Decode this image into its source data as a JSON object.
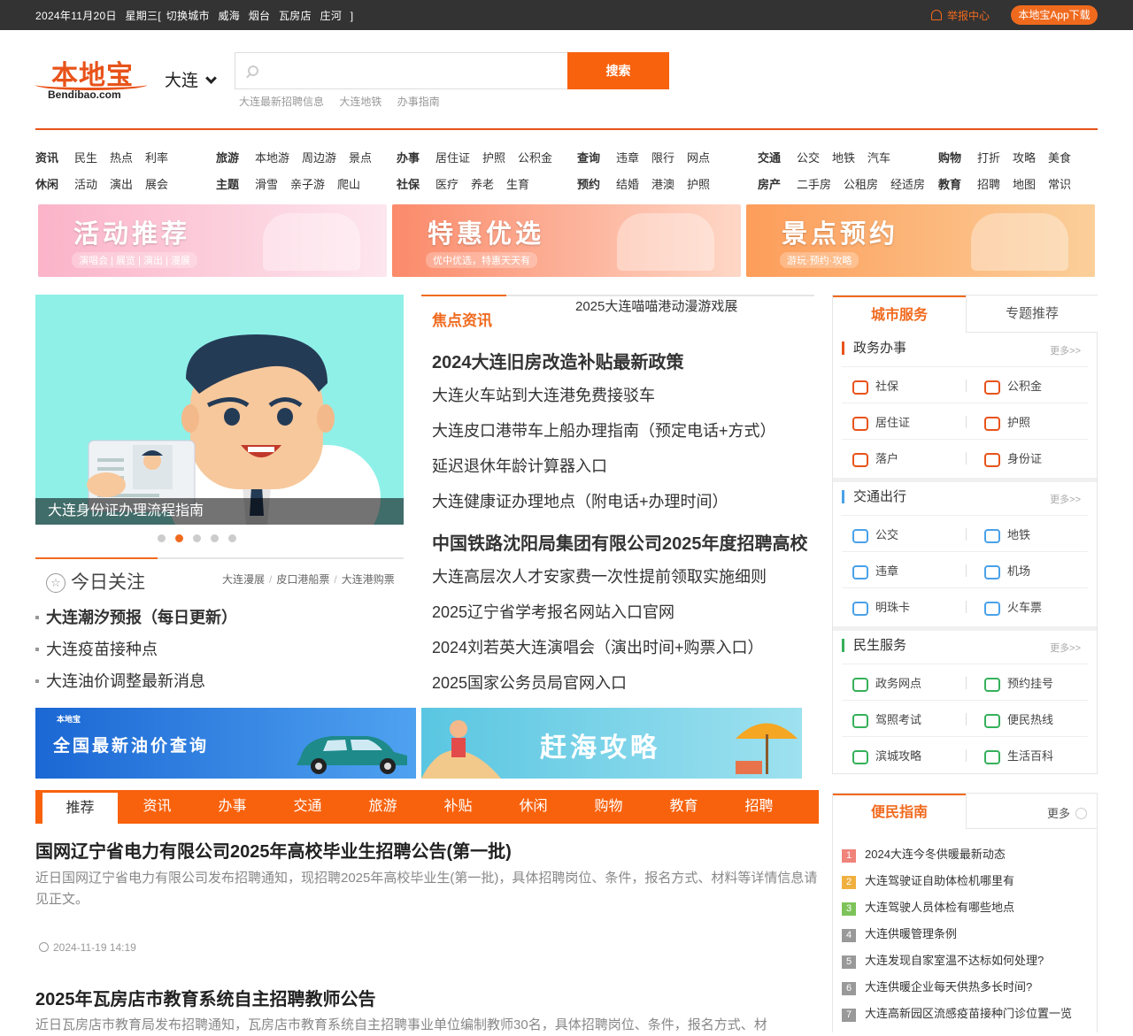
{
  "topbar": {
    "date": "2024年11月20日",
    "weekday": "星期三[",
    "switch_label": "切换城市",
    "cities": [
      "威海",
      "烟台",
      "瓦房店",
      "庄河"
    ],
    "close_bracket": "]",
    "report": "举报中心",
    "app_download": "本地宝App下载"
  },
  "header": {
    "logo_cn": "本地宝",
    "logo_en": "Bendibao.com",
    "city": "大连",
    "search_placeholder": "",
    "search_button": "搜索",
    "hot_links": [
      "大连最新招聘信息",
      "大连地铁",
      "办事指南"
    ]
  },
  "nav": {
    "groups": [
      {
        "rows": [
          [
            "资讯",
            "民生",
            "热点",
            "利率"
          ],
          [
            "休闲",
            "活动",
            "演出",
            "展会"
          ]
        ]
      },
      {
        "rows": [
          [
            "旅游",
            "本地游",
            "周边游",
            "景点"
          ],
          [
            "主题",
            "滑雪",
            "亲子游",
            "爬山"
          ]
        ]
      },
      {
        "rows": [
          [
            "办事",
            "居住证",
            "护照",
            "公积金"
          ],
          [
            "社保",
            "医疗",
            "养老",
            "生育"
          ]
        ]
      },
      {
        "rows": [
          [
            "查询",
            "违章",
            "限行",
            "网点"
          ],
          [
            "预约",
            "结婚",
            "港澳",
            "护照"
          ]
        ]
      },
      {
        "rows": [
          [
            "交通",
            "公交",
            "地铁",
            "汽车"
          ],
          [
            "房产",
            "二手房",
            "公租房",
            "经适房"
          ]
        ]
      },
      {
        "rows": [
          [
            "购物",
            "打折",
            "攻略",
            "美食"
          ],
          [
            "教育",
            "招聘",
            "地图",
            "常识"
          ]
        ]
      }
    ]
  },
  "banners": [
    {
      "title": "活动推荐",
      "sub": "演唱会 | 展览 | 演出 | 漫展",
      "color1": "#fbb3c8",
      "color2": "#fde6ee"
    },
    {
      "title": "特惠优选",
      "sub": "优中优选，特惠天天有",
      "color1": "#fb8a6a",
      "color2": "#fed7c6"
    },
    {
      "title": "景点预约",
      "sub": "游玩·预约·攻略",
      "color1": "#fd9d5a",
      "color2": "#fbcf9a"
    }
  ],
  "slider": {
    "caption": "大连身份证办理流程指南"
  },
  "focus": {
    "tag": "焦点资讯",
    "top": "2025大连喵喵港动漫游戏展",
    "items": [
      {
        "text": "2024大连旧房改造补贴最新政策",
        "bold": true
      },
      {
        "text": "大连火车站到大连港免费接驳车"
      },
      {
        "text": "大连皮口港带车上船办理指南（预定电话+方式）"
      },
      {
        "text": "延迟退休年龄计算器入口"
      },
      {
        "text": "大连健康证办理地点（附电话+办理时间）"
      },
      {
        "text": "中国铁路沈阳局集团有限公司2025年度招聘高校",
        "bold": true
      },
      {
        "text": "大连高层次人才安家费一次性提前领取实施细则"
      },
      {
        "text": "2025辽宁省学考报名网站入口官网"
      },
      {
        "text": "2024刘若英大连演唱会（演出时间+购票入口）"
      },
      {
        "text": "2025国家公务员局官网入口"
      }
    ]
  },
  "today": {
    "title": "今日关注",
    "links": [
      "大连漫展",
      "皮口港船票",
      "大连港购票"
    ],
    "items": [
      {
        "text": "大连潮汐预报（每日更新）",
        "bold": true
      },
      {
        "text": "大连疫苗接种点"
      },
      {
        "text": "大连油价调整最新消息"
      }
    ]
  },
  "ads": [
    {
      "logo": "本地宝",
      "title": "全国最新油价查询"
    },
    {
      "title": "赶海攻略"
    }
  ],
  "tabs": [
    "推荐",
    "资讯",
    "办事",
    "交通",
    "旅游",
    "补贴",
    "休闲",
    "购物",
    "教育",
    "招聘"
  ],
  "articles": [
    {
      "title": "国网辽宁省电力有限公司2025年高校毕业生招聘公告(第一批)",
      "desc": "近日国网辽宁省电力有限公司发布招聘通知，现招聘2025年高校毕业生(第一批)，具体招聘岗位、条件，报名方式、材料等详情信息请见正文。",
      "time": "2024-11-19 14:19"
    },
    {
      "title": "2025年瓦房店市教育系统自主招聘教师公告",
      "desc": "近日瓦房店市教育局发布招聘通知，瓦房店市教育系统自主招聘事业单位编制教师30名，具体招聘岗位、条件，报名方式、材"
    }
  ],
  "city_service": {
    "tab1": "城市服务",
    "tab2": "专题推荐",
    "more": "更多>>",
    "sections": [
      {
        "title": "政务办事",
        "items": [
          [
            "社保",
            "公积金"
          ],
          [
            "居住证",
            "护照"
          ],
          [
            "落户",
            "身份证"
          ]
        ]
      },
      {
        "title": "交通出行",
        "items": [
          [
            "公交",
            "地铁"
          ],
          [
            "违章",
            "机场"
          ],
          [
            "明珠卡",
            "火车票"
          ]
        ]
      },
      {
        "title": "民生服务",
        "items": [
          [
            "政务网点",
            "预约挂号"
          ],
          [
            "驾照考试",
            "便民热线"
          ],
          [
            "滨城攻略",
            "生活百科"
          ]
        ]
      }
    ]
  },
  "guide": {
    "title": "便民指南",
    "more": "更多",
    "items": [
      "2024大连今冬供暖最新动态",
      "大连驾驶证自助体检机哪里有",
      "大连驾驶人员体检有哪些地点",
      "大连供暖管理条例",
      "大连发现自家室温不达标如何处理?",
      "大连供暖企业每天供热多长时间?",
      "大连高新园区流感疫苗接种门诊位置一览"
    ],
    "num_colors": [
      "#f0837a",
      "#f0b040",
      "#7dc35a",
      "#999999",
      "#999999",
      "#999999",
      "#999999"
    ]
  }
}
